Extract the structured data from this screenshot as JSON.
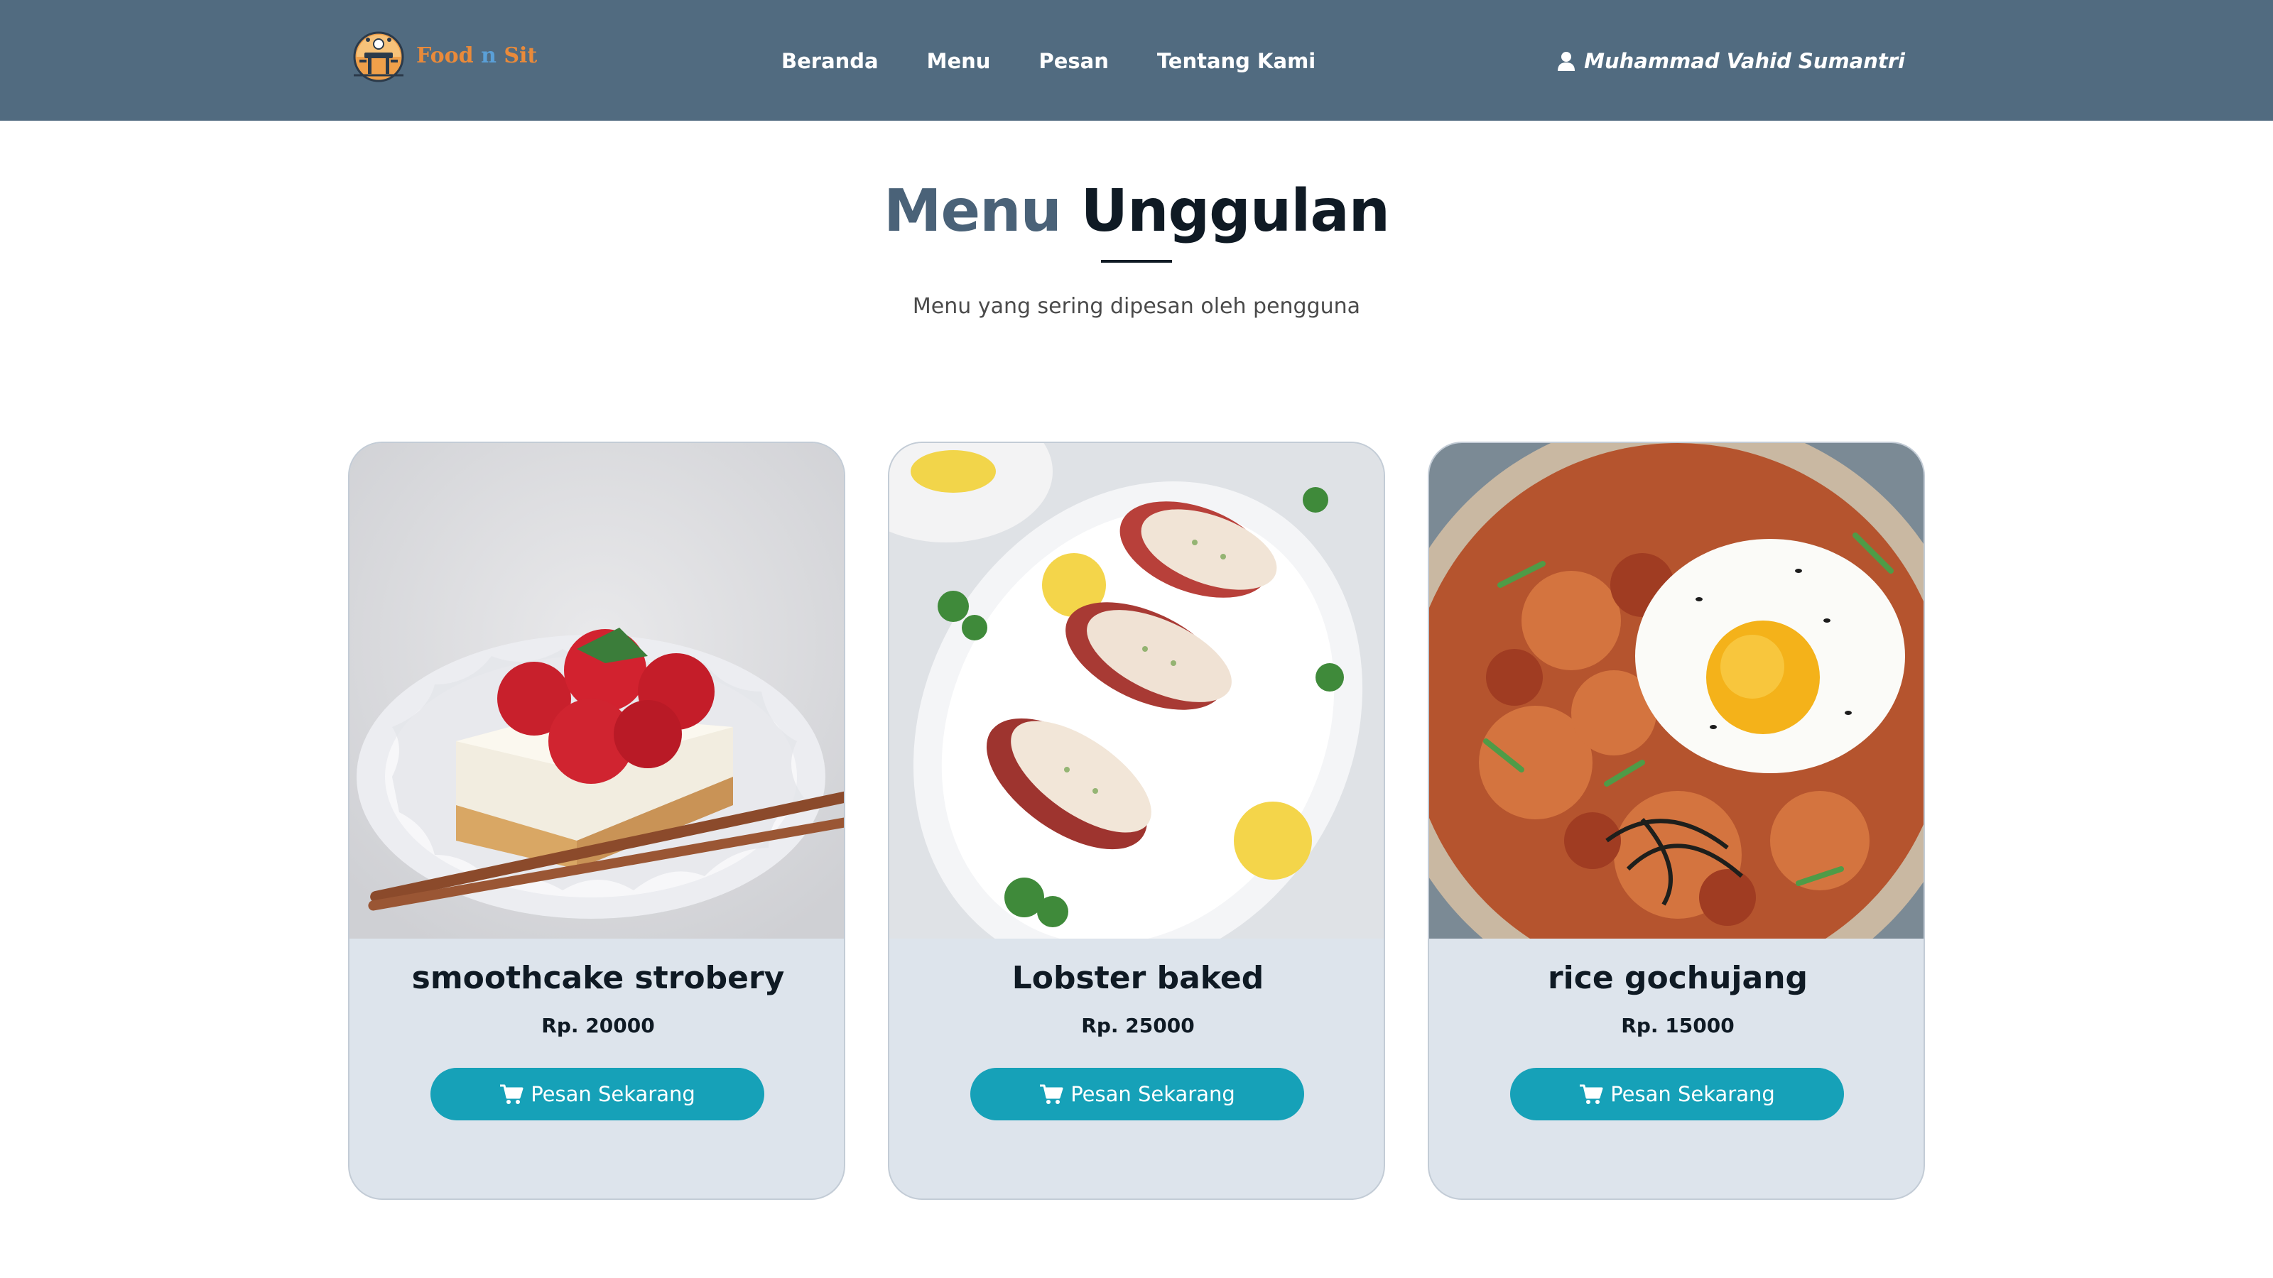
{
  "header": {
    "logo_text_left": "Food",
    "logo_text_mid": "n",
    "logo_text_right": "Sit",
    "nav": [
      "Beranda",
      "Menu",
      "Pesan",
      "Tentang Kami"
    ],
    "user_name": "Muhammad Vahid Sumantri"
  },
  "section": {
    "title_part1": "Menu",
    "title_part2": "Unggulan",
    "subtitle": "Menu yang sering dipesan oleh pengguna"
  },
  "cards": [
    {
      "name": "smoothcake strobery",
      "price": "Rp. 20000",
      "button": "Pesan Sekarang"
    },
    {
      "name": "Lobster baked",
      "price": "Rp. 25000",
      "button": "Pesan Sekarang"
    },
    {
      "name": "rice gochujang",
      "price": "Rp. 15000",
      "button": "Pesan Sekarang"
    }
  ],
  "colors": {
    "navbar": "#516b80",
    "title_accent": "#4a6278",
    "button": "#16a1b8",
    "card_bg": "#dde4ec"
  },
  "icons": {
    "user": "user-icon",
    "cart": "cart-icon"
  }
}
